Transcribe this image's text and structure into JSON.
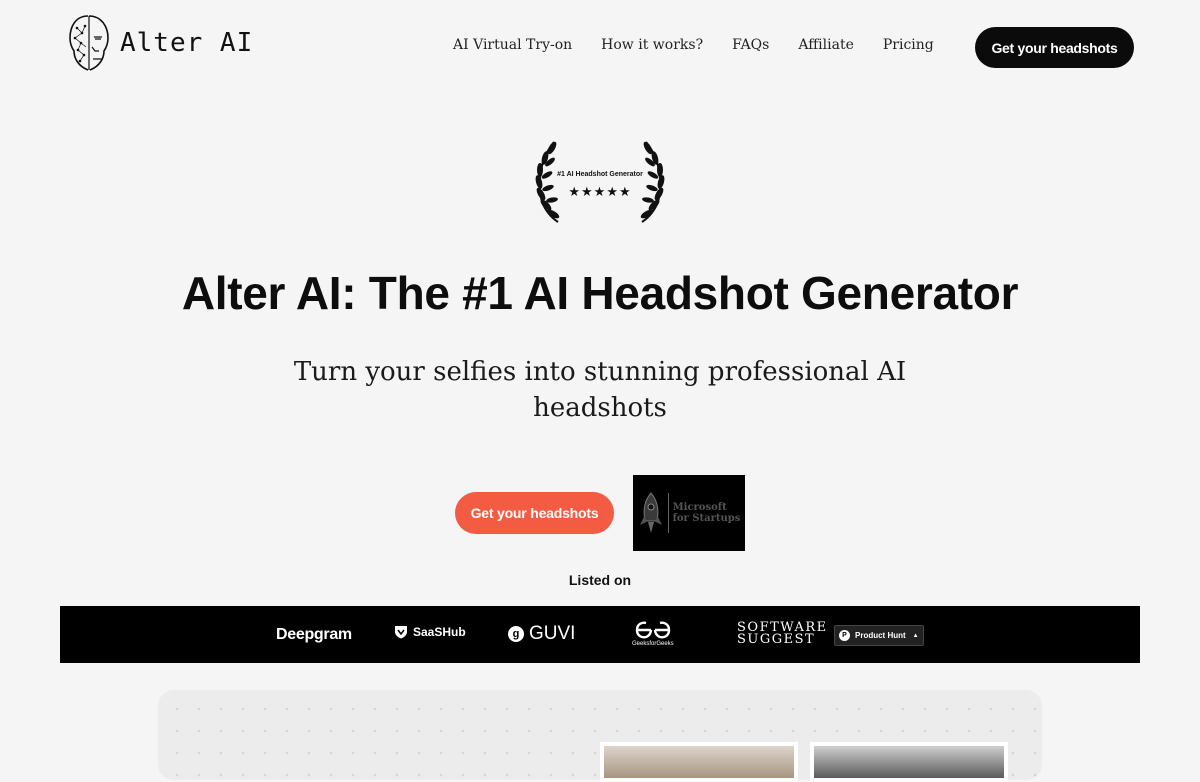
{
  "header": {
    "brand": "Alter AI",
    "logo_icon": "face-icon",
    "nav": [
      {
        "label": "AI Virtual Try-on"
      },
      {
        "label": "How it works?"
      },
      {
        "label": "FAQs"
      },
      {
        "label": "Affiliate"
      },
      {
        "label": "Pricing"
      }
    ],
    "cta_label": "Get your headshots"
  },
  "award": {
    "title": "#1 AI Headshot Generator",
    "stars": "★★★★★",
    "icon": "laurel-wreath-icon"
  },
  "hero": {
    "title": "Alter AI: The #1 AI Headshot Generator",
    "subtitle": "Turn your selfies into stunning professional AI headshots",
    "cta_label": "Get your headshots",
    "badge_text_line1": "Microsoft",
    "badge_text_line2": "for Startups",
    "badge_icon": "rocket-icon"
  },
  "listed_on": {
    "label": "Listed on",
    "logos": {
      "deepgram": "Deepgram",
      "saashub": "SaaSHub",
      "guvi": "GUVI",
      "gfg_label": "GeeksforGeeks",
      "software_suggest": "SOFTWARE SUGGEST",
      "product_hunt": "Product Hunt"
    }
  },
  "colors": {
    "background": "#f5f5f5",
    "primary_dark": "#0b0b0b",
    "accent": "#f35b43",
    "strip": "#000000"
  }
}
